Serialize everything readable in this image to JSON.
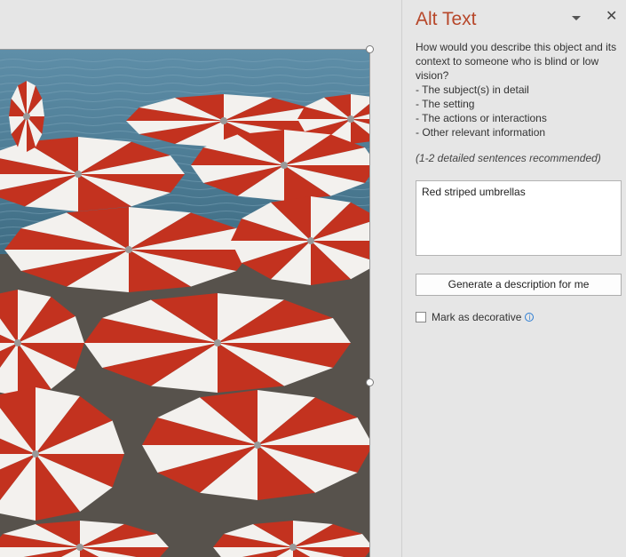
{
  "pane": {
    "title": "Alt Text",
    "prompt_lines": [
      "How would you describe this object and its",
      "context to someone who is blind or low",
      "vision?",
      "- The subject(s) in detail",
      "- The setting",
      "- The actions or interactions",
      "- Other relevant information"
    ],
    "hint": "(1-2 detailed sentences recommended)",
    "alt_text_value": "Red striped umbrellas",
    "generate_button": "Generate a description for me",
    "decorative_label": "Mark as decorative",
    "decorative_checked": false,
    "icons": {
      "menu": "chevron-down-icon",
      "close": "close-icon",
      "info": "info-icon"
    }
  },
  "image": {
    "subject": "photo-beach-umbrellas",
    "colors": {
      "sea": "#4f7f98",
      "umbrella_red": "#c3321f",
      "umbrella_white": "#f3f1ee",
      "sand": "#5a544e"
    }
  },
  "colors": {
    "title": "#b7472a",
    "pane_bg": "#e6e6e6",
    "info_blue": "#2b7cd3"
  }
}
